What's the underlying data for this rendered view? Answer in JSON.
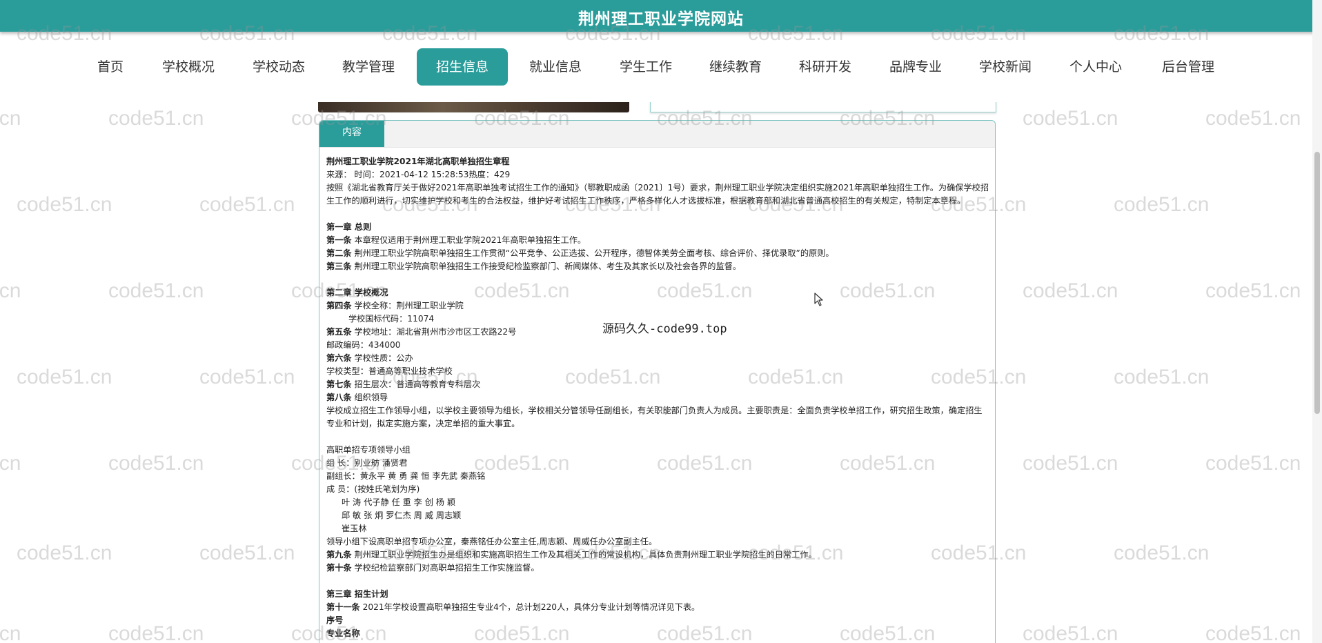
{
  "header": {
    "site_title": "荆州理工职业学院网站"
  },
  "nav": {
    "items": [
      {
        "label": "首页"
      },
      {
        "label": "学校概况"
      },
      {
        "label": "学校动态"
      },
      {
        "label": "教学管理"
      },
      {
        "label": "招生信息",
        "active": true
      },
      {
        "label": "就业信息"
      },
      {
        "label": "学生工作"
      },
      {
        "label": "继续教育"
      },
      {
        "label": "科研开发"
      },
      {
        "label": "品牌专业"
      },
      {
        "label": "学校新闻"
      },
      {
        "label": "个人中心"
      },
      {
        "label": "后台管理"
      }
    ]
  },
  "panel": {
    "tab_label": "内容"
  },
  "article": {
    "title": "荆州理工职业学院2021年湖北高职单独招生章程",
    "meta": "来源： 时间：2021-04-12 15:28:53热度：429",
    "intro": "按照《湖北省教育厅关于做好2021年高职单独考试招生工作的通知》（鄂教职成函〔2021〕1号）要求，荆州理工职业学院决定组织实施2021年高职单独招生工作。为确保学校招生工作的顺利进行，切实维护学校和考生的合法权益，维护好考试招生工作秩序，严格多样化人才选拔标准，根据教育部和湖北省普通高校招生的有关规定，特制定本章程。",
    "ch1_title": "第一章 总则",
    "art1_label": "第一条",
    "art1_text": "本章程仅适用于荆州理工职业学院2021年高职单独招生工作。",
    "art2_label": "第二条",
    "art2_text": "荆州理工职业学院高职单独招生工作贯彻“公平竞争、公正选拔、公开程序，德智体美劳全面考核、综合评价、择优录取”的原则。",
    "art3_label": "第三条",
    "art3_text": "荆州理工职业学院高职单独招生工作接受纪检监察部门、新闻媒体、考生及其家长以及社会各界的监督。",
    "ch2_title": "第二章 学校概况",
    "art4_label": "第四条",
    "art4_text": "学校全称：荆州理工职业学院",
    "art4_code": "学校国标代码：11074",
    "art5_label": "第五条",
    "art5_text": "学校地址：湖北省荆州市沙市区工农路22号",
    "postcode": "邮政编码：434000",
    "art6_label": "第六条",
    "art6_text": "学校性质：公办",
    "school_type": "学校类型：普通高等职业技术学校",
    "art7_label": "第七条",
    "art7_text": "招生层次：普通高等教育专科层次",
    "art8_label": "第八条",
    "art8_text": "组织领导",
    "art8_body": "学校成立招生工作领导小组，以学校主要领导为组长，学校相关分管领导任副组长，有关职能部门负责人为成员。主要职责是：全面负责学校单招工作，研究招生政策，确定招生专业和计划，拟定实施方案，决定单招的重大事宜。",
    "group_title": "高职单招专项领导小组",
    "group_leader": "组 长：别业舫 潘贤君",
    "group_deputy": "副组长：黄永平 黄 勇 龚 恒 李先武 秦燕铭",
    "group_members": "成 员：(按姓氏笔划为序)",
    "members_1": "叶 涛 代子静 任 重 李 创 杨 颖",
    "members_2": "邱 敏 张 炯 罗仁杰 周 威 周志颖",
    "members_3": "崔玉林",
    "office_note": "领导小组下设高职单招专项办公室，秦燕铭任办公室主任,周志颖、周威任办公室副主任。",
    "art9_label": "第九条",
    "art9_text": "荆州理工职业学院招生办是组织和实施高职招生工作及其相关工作的常设机构，具体负责荆州理工职业学院招生的日常工作。",
    "art10_label": "第十条",
    "art10_text": "学校纪检监察部门对高职单招招生工作实施监督。",
    "ch3_title": "第三章 招生计划",
    "art11_label": "第十一条",
    "art11_text": "2021年学校设置高职单独招生专业4个，总计划220人，具体分专业计划等情况详见下表。",
    "table_col1": "序号",
    "table_col2": "专业名称"
  },
  "overlay": {
    "center_note": "源码久久-code99.top",
    "watermark": "code51.cn"
  }
}
